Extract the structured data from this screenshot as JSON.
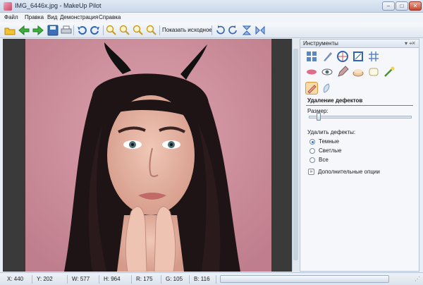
{
  "window": {
    "title": "IMG_6446x.jpg - MakeUp Pilot",
    "minimize": "–",
    "maximize": "□",
    "close": "✕"
  },
  "menu": [
    "Файл",
    "Правка",
    "Вид",
    "Демонстрация",
    "Справка"
  ],
  "toolbar": {
    "show_original": "Показать исходное",
    "icons": [
      "open-icon",
      "back-arrow-icon",
      "forward-arrow-icon",
      "save-icon",
      "print-icon",
      "undo-icon",
      "redo-icon",
      "zoom-in-icon",
      "zoom-out-icon",
      "zoom-fit-icon",
      "zoom-actual-icon",
      "rotate-left-icon",
      "rotate-right-icon",
      "flip-vertical-icon",
      "flip-horizontal-icon"
    ]
  },
  "panel": {
    "title": "Инструменты",
    "pin": "▾ ⌖",
    "close": "×",
    "section_title": "Удаление дефектов",
    "size_label": "Размер:",
    "size_value": 0.08,
    "remove_label": "Удалить дефекты:",
    "options": [
      {
        "label": "Темные",
        "selected": true
      },
      {
        "label": "Светлые",
        "selected": false
      },
      {
        "label": "Все",
        "selected": false
      }
    ],
    "more_options": "Дополнительные опции",
    "more_options_icon": "»"
  },
  "status": {
    "x": "X: 440",
    "y": "Y: 202",
    "w": "W: 577",
    "h": "H: 964",
    "r": "R: 175",
    "g": "G: 105",
    "b": "B: 116",
    "grip": "⋰"
  },
  "colors": {
    "accent": "#2c6fd1",
    "photo_bg": "#c98a98",
    "active_tool": "#f8d9a8"
  }
}
